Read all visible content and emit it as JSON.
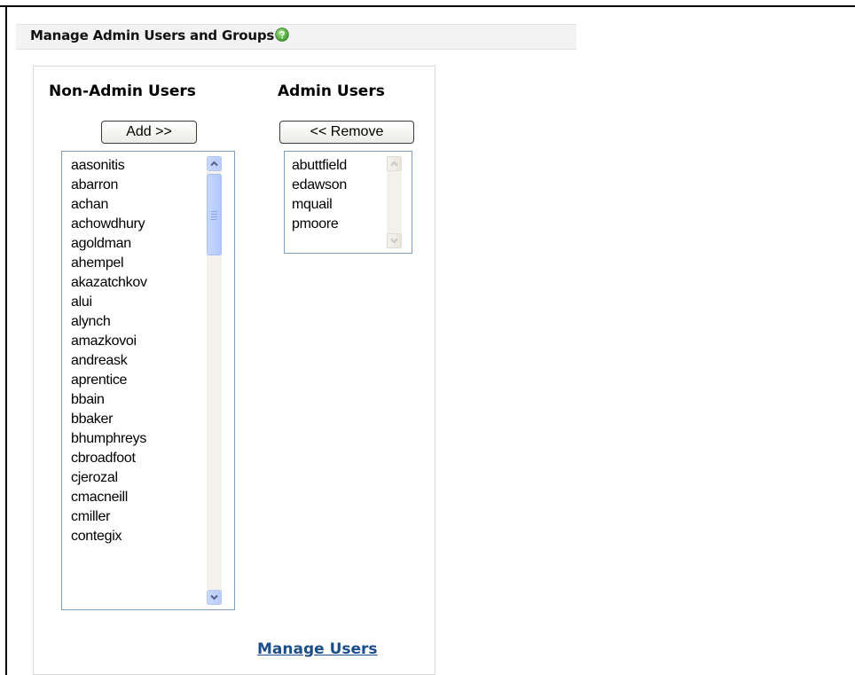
{
  "header": {
    "title": "Manage Admin Users and Groups",
    "help_icon": "help-icon"
  },
  "non_admin": {
    "title": "Non-Admin Users",
    "add_label": "Add >>",
    "users": [
      "aasonitis",
      "abarron",
      "achan",
      "achowdhury",
      "agoldman",
      "ahempel",
      "akazatchkov",
      "alui",
      "alynch",
      "amazkovoi",
      "andreask",
      "aprentice",
      "bbain",
      "bbaker",
      "bhumphreys",
      "cbroadfoot",
      "cjerozal",
      "cmacneill",
      "cmiller",
      "contegix"
    ]
  },
  "admin": {
    "title": "Admin Users",
    "remove_label": "<< Remove",
    "users": [
      "abuttfield",
      "edawson",
      "mquail",
      "pmoore"
    ]
  },
  "footer": {
    "manage_users_label": "Manage Users"
  },
  "colors": {
    "header_bg": "#f3f3f3",
    "help_icon_green": "#4caf3a",
    "link": "#1c4f8a",
    "listbox_border": "#7f9db9",
    "scrollbar_blue": "#c1d3fb"
  }
}
